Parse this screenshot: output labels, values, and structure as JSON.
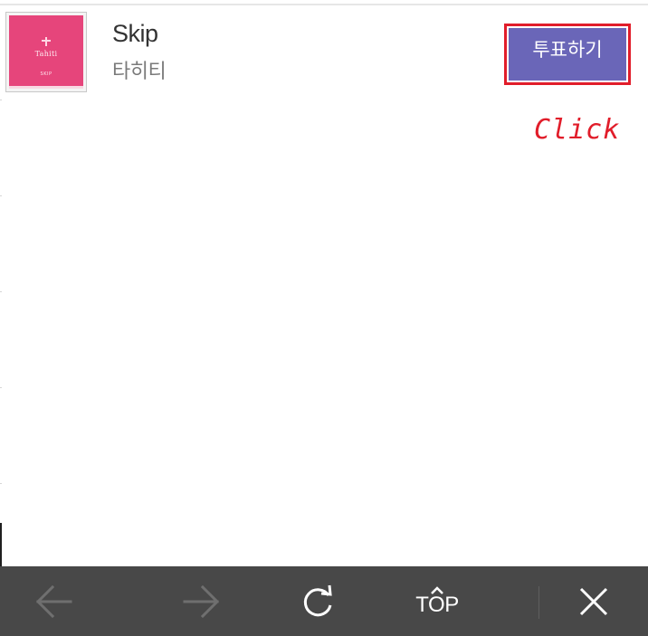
{
  "song": {
    "title": "Skip",
    "artist": "타히티",
    "album_cover_text": "Tahiti",
    "album_cover_sub": "SKIP"
  },
  "vote": {
    "label": "투표하기",
    "color": "#6a66b8",
    "highlight_color": "#e11d2a"
  },
  "annotation": {
    "text": "Click",
    "color": "#e11d2a"
  },
  "toolbar": {
    "background": "#484848",
    "items": [
      {
        "icon": "arrow-left-icon",
        "enabled": false
      },
      {
        "icon": "arrow-right-icon",
        "enabled": false
      },
      {
        "icon": "refresh-icon",
        "enabled": true
      },
      {
        "icon": "scroll-top-icon",
        "label": "TOP",
        "enabled": true
      },
      {
        "icon": "close-icon",
        "enabled": true
      }
    ]
  }
}
